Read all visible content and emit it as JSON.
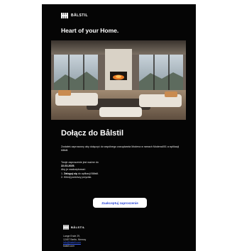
{
  "brand": {
    "name": "BÅLSTIL"
  },
  "email": {
    "headline": "Heart of your Home.",
    "title": "Dołącz do Bålstil",
    "intro": "Zostałeś zaproszony aby dołączyć do wspólnego zarządzania Modena w ramach Modena001 w aplikacji bålstil.",
    "expiry_line": "Twoje zaproszenie jest ważne do",
    "expiry_date": "22-03-2025.",
    "steps_heading": "Aby je zaakceptować:",
    "steps": [
      {
        "num": "1.",
        "bold": "Zaloguj się",
        "rest": "do aplikacji Bålstil."
      },
      {
        "num": "2.",
        "bold": "",
        "rest": "Kliknij poniższy przycisk."
      }
    ],
    "cta_label": "Zaakceptuj zaproszenie"
  },
  "footer": {
    "brand": "BÅLSTIL",
    "address_line1": "Lange Ende 29,",
    "address_line2": "12457 Berlin, Niemcy",
    "email": "info@balstil.com",
    "website": "balstil.com"
  },
  "colors": {
    "background": "#050505",
    "text": "#ffffff",
    "cta_text": "#2b46d8",
    "link": "#3a63ff"
  }
}
